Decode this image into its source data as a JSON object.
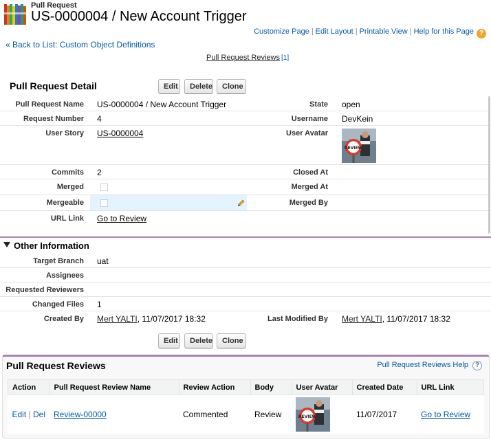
{
  "header": {
    "object_label": "Pull Request",
    "title": "US-0000004 / New Account Trigger",
    "links": [
      "Customize Page",
      "Edit Layout",
      "Printable View",
      "Help for this Page"
    ],
    "help_glyph": "?"
  },
  "back_link": "« Back to List: Custom Object Definitions",
  "related_hover": {
    "label": "Pull Request Reviews",
    "count": "[1]"
  },
  "detail": {
    "title": "Pull Request Detail",
    "buttons": {
      "edit": "Edit",
      "delete": "Delete",
      "clone": "Clone"
    },
    "fields": {
      "pull_request_name": {
        "label": "Pull Request Name",
        "value": "US-0000004 / New Account Trigger"
      },
      "state": {
        "label": "State",
        "value": "open"
      },
      "request_number": {
        "label": "Request Number",
        "value": "4"
      },
      "username": {
        "label": "Username",
        "value": "DevKein"
      },
      "user_story": {
        "label": "User Story",
        "value": "US-0000004"
      },
      "user_avatar": {
        "label": "User Avatar"
      },
      "commits": {
        "label": "Commits",
        "value": "2"
      },
      "closed_at": {
        "label": "Closed At",
        "value": ""
      },
      "merged": {
        "label": "Merged",
        "checked": false
      },
      "merged_at": {
        "label": "Merged At",
        "value": ""
      },
      "mergeable": {
        "label": "Mergeable",
        "checked": false
      },
      "merged_by": {
        "label": "Merged By",
        "value": ""
      },
      "url_link": {
        "label": "URL Link",
        "value": "Go to Review"
      }
    }
  },
  "other_info": {
    "title": "Other Information",
    "fields": {
      "target_branch": {
        "label": "Target Branch",
        "value": "uat"
      },
      "assignees": {
        "label": "Assignees",
        "value": ""
      },
      "requested_reviewers": {
        "label": "Requested Reviewers",
        "value": ""
      },
      "changed_files": {
        "label": "Changed Files",
        "value": "1"
      },
      "created_by": {
        "label": "Created By",
        "user": "Mert YALTI",
        "date": ", 11/07/2017 18:32"
      },
      "last_modified_by": {
        "label": "Last Modified By",
        "user": "Mert YALTI",
        "date": ", 11/07/2017 18:32"
      }
    }
  },
  "reviews": {
    "title": "Pull Request Reviews",
    "help": "Pull Request Reviews Help",
    "help_glyph": "?",
    "columns": [
      "Action",
      "Pull Request Review Name",
      "Review Action",
      "Body",
      "User Avatar",
      "Created Date",
      "URL Link"
    ],
    "row": {
      "edit": "Edit",
      "sep": "|",
      "del": "Del",
      "name": "Review-00000",
      "review_action": "Commented",
      "body": "Review",
      "created_date": "11/07/2017",
      "url": "Go to Review"
    }
  },
  "colors": {
    "accent": "#a982b3",
    "link": "#015ba7",
    "help_icon": "#f0a52c"
  }
}
